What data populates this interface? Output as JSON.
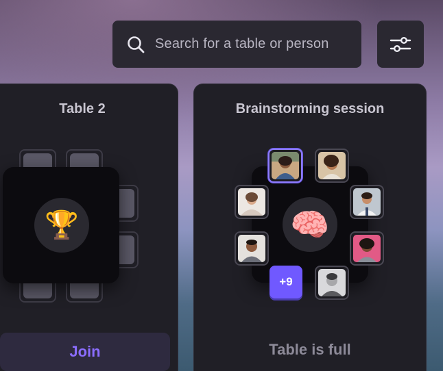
{
  "search": {
    "placeholder": "Search for a table or person"
  },
  "filter": {
    "icon": "sliders-icon"
  },
  "tables": [
    {
      "title": "Table 2",
      "center_icon": "🏆",
      "action_label": "Join"
    },
    {
      "title": "Brainstorming session",
      "center_icon": "🧠",
      "status_label": "Table is full",
      "overflow_count": "+9"
    }
  ],
  "colors": {
    "accent": "#7059ff",
    "join_text": "#8b6dff",
    "card": "#201f26"
  }
}
